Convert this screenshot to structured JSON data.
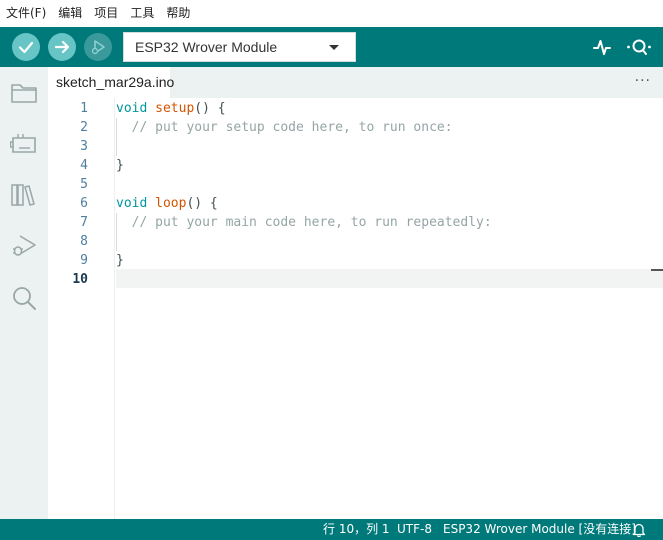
{
  "menu": [
    "文件(F)",
    "编辑",
    "项目",
    "工具",
    "帮助"
  ],
  "toolbar": {
    "verify_icon": "check-icon",
    "upload_icon": "arrow-right-icon",
    "debug_icon": "debug-play-icon",
    "board": "ESP32 Wrover Module",
    "serial_plotter_icon": "pulse-icon",
    "serial_monitor_icon": "magnifier-dots-icon"
  },
  "sidebar": {
    "items": [
      "folder-icon",
      "board-icon",
      "library-icon",
      "debug-icon",
      "search-icon"
    ]
  },
  "tab": {
    "filename": "sketch_mar29a.ino",
    "more": "···"
  },
  "editor": {
    "line_numbers": [
      "1",
      "2",
      "3",
      "4",
      "5",
      "6",
      "7",
      "8",
      "9",
      "10"
    ],
    "active_line": 10,
    "lines": [
      {
        "kw": "void",
        "fn": "setup",
        "rest": "() {"
      },
      {
        "comment": "  // put your setup code here, to run once:"
      },
      {
        "text": ""
      },
      {
        "text": "}"
      },
      {
        "text": ""
      },
      {
        "kw": "void",
        "fn": "loop",
        "rest": "() {"
      },
      {
        "comment": "  // put your main code here, to run repeatedly:"
      },
      {
        "text": ""
      },
      {
        "text": "}"
      },
      {
        "text": ""
      }
    ]
  },
  "status": {
    "position": "行 10，列 1",
    "encoding": "UTF-8",
    "board": "ESP32 Wrover Module [没有连接]",
    "bell_icon": "bell-icon"
  },
  "colors": {
    "accent": "#00797a",
    "button": "#67c5c6",
    "keyword": "#00979d",
    "function": "#d35400",
    "comment": "#95a5a6"
  }
}
